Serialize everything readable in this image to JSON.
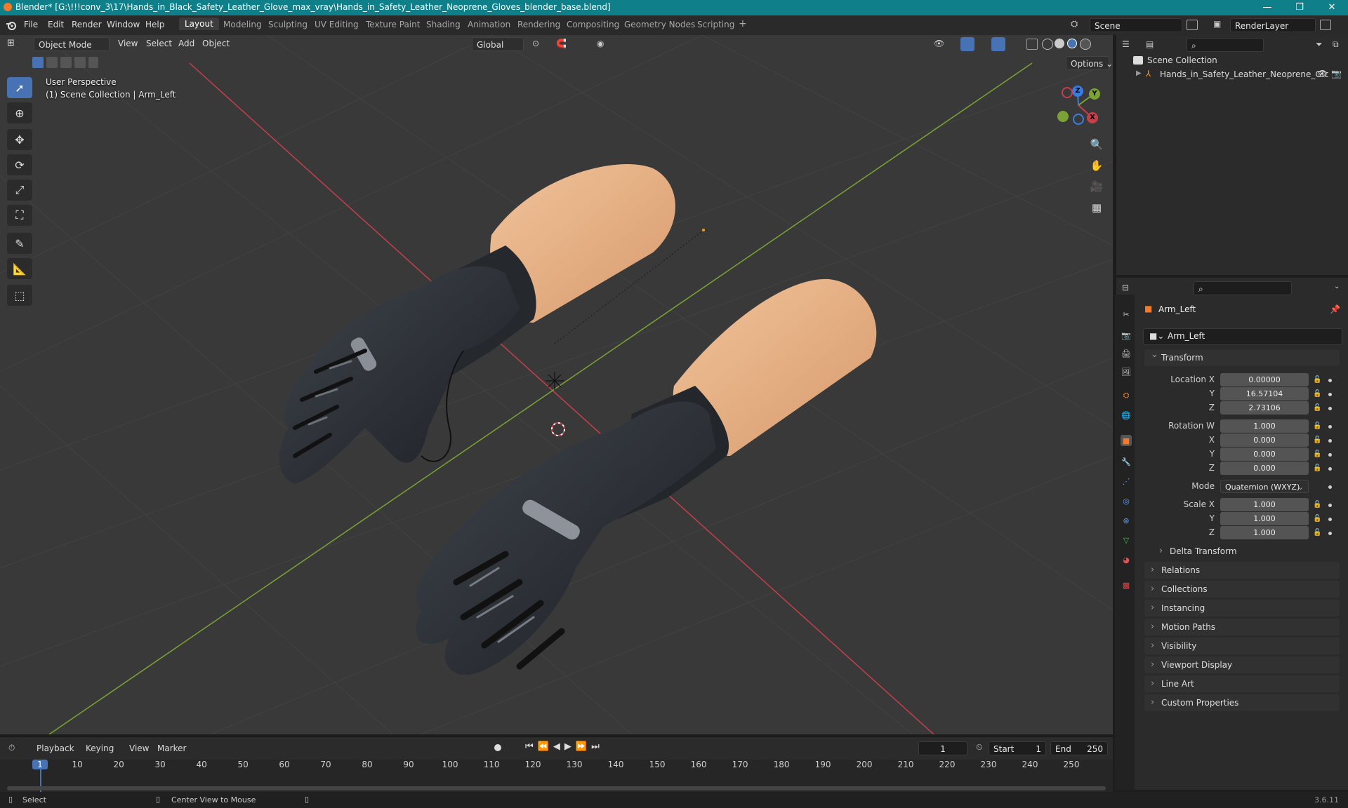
{
  "window": {
    "title": "Blender* [G:\\!!!conv_3\\17\\Hands_in_Black_Safety_Leather_Glove_max_vray\\Hands_in_Safety_Leather_Neoprene_Gloves_blender_base.blend]",
    "controls": {
      "minimize": "—",
      "maximize": "❐",
      "close": "✕"
    }
  },
  "menubar": {
    "items": [
      "File",
      "Edit",
      "Render",
      "Window",
      "Help"
    ],
    "workspaces": [
      "Layout",
      "Modeling",
      "Sculpting",
      "UV Editing",
      "Texture Paint",
      "Shading",
      "Animation",
      "Rendering",
      "Compositing",
      "Geometry Nodes",
      "Scripting"
    ],
    "active_workspace": "Layout",
    "add_tab": "+",
    "scene": "Scene",
    "view_layer": "RenderLayer"
  },
  "viewport": {
    "mode": "Object Mode",
    "menus": [
      "View",
      "Select",
      "Add",
      "Object"
    ],
    "transform_orientation": "Global",
    "options_label": "Options",
    "perspective_label": "User Perspective",
    "collection_label": "(1) Scene Collection | Arm_Left",
    "gizmo": {
      "x": "X",
      "y": "Y",
      "z": "Z"
    },
    "colors": {
      "x_axis": "#c3404b",
      "y_axis": "#7ba235",
      "z_axis": "#3a7de0",
      "grid": "#424242"
    }
  },
  "outliner": {
    "root": "Scene Collection",
    "items": [
      {
        "label": "Hands_in_Safety_Leather_Neoprene_Glc"
      }
    ]
  },
  "properties": {
    "object_name": "Arm_Left",
    "object_field": "Arm_Left",
    "transform": {
      "header": "Transform",
      "location_label": "Location X",
      "location": [
        "0.00000",
        "16.57104",
        "2.73106"
      ],
      "rotation_label": "Rotation W",
      "rotation": [
        "1.000",
        "0.000",
        "0.000",
        "0.000"
      ],
      "mode_label": "Mode",
      "mode": "Quaternion (WXYZ)",
      "scale_label": "Scale X",
      "scale": [
        "1.000",
        "1.000",
        "1.000"
      ],
      "axis_y": "Y",
      "axis_z": "Z",
      "axis_x": "X",
      "delta": "Delta Transform"
    },
    "sections": [
      "Relations",
      "Collections",
      "Instancing",
      "Motion Paths",
      "Visibility",
      "Viewport Display",
      "Line Art",
      "Custom Properties"
    ]
  },
  "timeline": {
    "menus": [
      "Playback",
      "Keying",
      "View",
      "Marker"
    ],
    "current_frame": "1",
    "start_label": "Start",
    "start": "1",
    "end_label": "End",
    "end": "250",
    "ticks": [
      "1",
      "10",
      "20",
      "30",
      "40",
      "50",
      "60",
      "70",
      "80",
      "90",
      "100",
      "110",
      "120",
      "130",
      "140",
      "150",
      "160",
      "170",
      "180",
      "190",
      "200",
      "210",
      "220",
      "230",
      "240",
      "250"
    ]
  },
  "statusbar": {
    "left": "Select",
    "middle": "Center View to Mouse",
    "version": "3.6.11"
  }
}
